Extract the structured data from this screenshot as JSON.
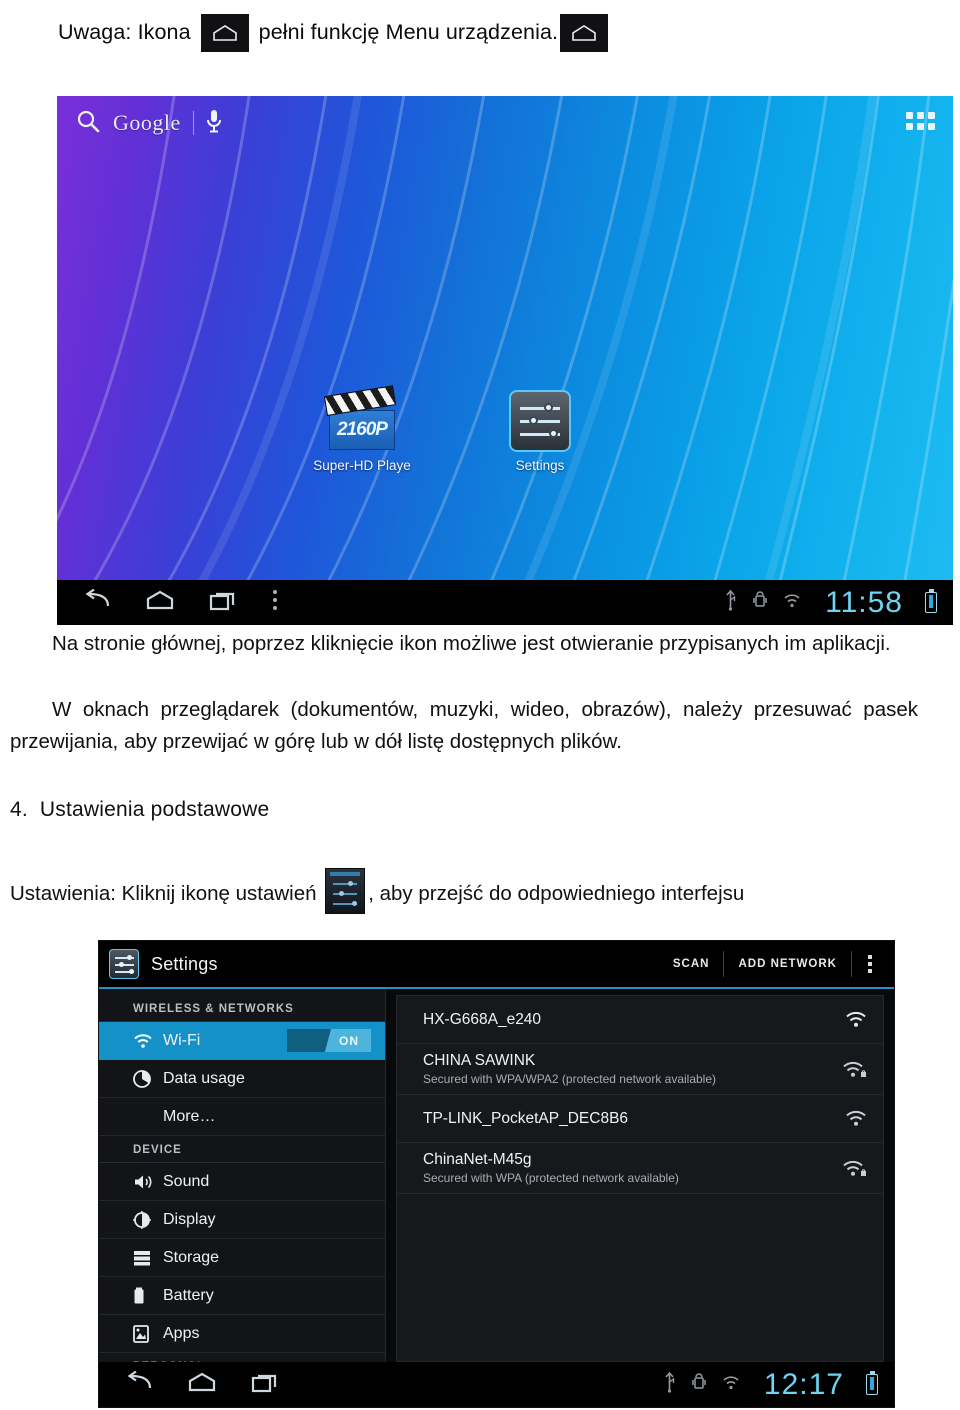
{
  "document": {
    "note": {
      "before": "Uwaga: Ikona",
      "after": "pełni funkcję Menu urządzenia.",
      "icon_name": "home-icon"
    },
    "paragraph_1": "Na stronie głównej, poprzez kliknięcie ikon możliwe jest otwieranie przypisanych im aplikacji.",
    "paragraph_2": "W oknach przeglądarek (dokumentów, muzyki, wideo, obrazów), należy przesuwać pasek przewijania, aby przewijać w górę lub w dół listę dostępnych plików.",
    "heading": {
      "number": "4.",
      "text": "Ustawienia podstawowe"
    },
    "settings_paragraph": {
      "before": "Ustawienia: Kliknij ikonę ustawień",
      "after": ", aby przejść do odpowiedniego interfejsu"
    }
  },
  "home_screen": {
    "search": {
      "label": "Google",
      "search_icon": "search-icon",
      "mic_icon": "microphone-icon"
    },
    "apps_button": "apps-grid-icon",
    "icons": [
      {
        "label": "Super-HD Playe",
        "icon": "hd-player-icon",
        "badge": "2160P"
      },
      {
        "label": "Settings",
        "icon": "settings-sliders-icon"
      }
    ],
    "navbar": {
      "back": "back-icon",
      "home": "home-icon",
      "recents": "recents-icon",
      "menu": "menu-dots-icon",
      "status_icons": [
        "usb-icon",
        "android-icon",
        "wifi-icon"
      ],
      "clock": "11:58",
      "battery": "battery-charging-icon"
    }
  },
  "settings_screen": {
    "header": {
      "title": "Settings",
      "icon": "settings-sliders-icon",
      "actions": [
        "SCAN",
        "ADD NETWORK"
      ],
      "overflow": "overflow-menu-icon"
    },
    "sidebar": [
      {
        "type": "section",
        "label": "WIRELESS & NETWORKS"
      },
      {
        "type": "item",
        "label": "Wi-Fi",
        "icon": "wifi-icon",
        "active": true,
        "toggle": "ON"
      },
      {
        "type": "item",
        "label": "Data usage",
        "icon": "data-usage-icon"
      },
      {
        "type": "item",
        "label": "More…",
        "icon": null
      },
      {
        "type": "section",
        "label": "DEVICE"
      },
      {
        "type": "item",
        "label": "Sound",
        "icon": "sound-icon"
      },
      {
        "type": "item",
        "label": "Display",
        "icon": "display-icon"
      },
      {
        "type": "item",
        "label": "Storage",
        "icon": "storage-icon"
      },
      {
        "type": "item",
        "label": "Battery",
        "icon": "battery-icon"
      },
      {
        "type": "item",
        "label": "Apps",
        "icon": "apps-icon"
      },
      {
        "type": "section",
        "label": "PERSONAL"
      }
    ],
    "networks": [
      {
        "ssid": "HX-G668A_e240",
        "security": "",
        "secured": false
      },
      {
        "ssid": "CHINA SAWINK",
        "security": "Secured with WPA/WPA2 (protected network available)",
        "secured": true
      },
      {
        "ssid": "TP-LINK_PocketAP_DEC8B6",
        "security": "",
        "secured": false
      },
      {
        "ssid": "ChinaNet-M45g",
        "security": "Secured with WPA (protected network available)",
        "secured": true
      }
    ],
    "navbar": {
      "back": "back-icon",
      "home": "home-icon",
      "recents": "recents-icon",
      "status_icons": [
        "usb-icon",
        "android-icon",
        "wifi-icon"
      ],
      "clock": "12:17",
      "battery": "battery-charging-icon"
    }
  },
  "colors": {
    "accent_blue": "#1492c8",
    "clock_blue": "#6fd3f2",
    "wallpaper_left": "#7a2fd8",
    "wallpaper_right": "#1fbcf2"
  }
}
